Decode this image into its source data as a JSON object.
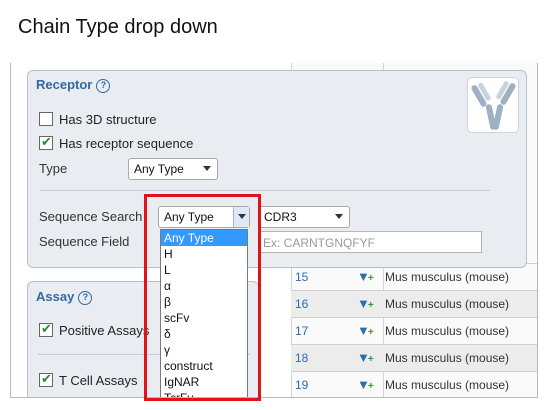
{
  "caption": "Chain Type drop down",
  "results": {
    "rows": [
      {
        "num": "15",
        "organism": "Mus musculus (mouse)"
      },
      {
        "num": "16",
        "organism": "Mus musculus (mouse)"
      },
      {
        "num": "17",
        "organism": "Mus musculus (mouse)"
      },
      {
        "num": "18",
        "organism": "Mus musculus (mouse)"
      },
      {
        "num": "19",
        "organism": "Mus musculus (mouse)"
      }
    ],
    "filter_icon": "funnel-plus-icon"
  },
  "receptor": {
    "title": "Receptor",
    "help": "?",
    "has_3d_label": "Has 3D structure",
    "has_3d_checked": false,
    "has_seq_label": "Has receptor sequence",
    "has_seq_checked": true,
    "type_label": "Type",
    "type_value": "Any Type",
    "seq_search_label": "Sequence Search",
    "chain_value": "Any Type",
    "cdr_value": "CDR3",
    "seq_field_label": "Sequence Field",
    "seq_placeholder": "Ex: CARNTGNQFYF"
  },
  "assay": {
    "title": "Assay",
    "help": "?",
    "positive_label": "Positive Assays",
    "positive_checked": true,
    "tcell_label": "T Cell Assays",
    "tcell_checked": true
  },
  "dropdown": {
    "options": [
      "Any Type",
      "H",
      "L",
      "α",
      "β",
      "scFv",
      "δ",
      "γ",
      "construct",
      "IgNAR",
      "TcrFv"
    ],
    "selected_index": 0
  },
  "colors": {
    "accent": "#2f6aa6",
    "highlight": "#e0131a",
    "selected": "#3399ff",
    "check": "#2a8a2e"
  }
}
